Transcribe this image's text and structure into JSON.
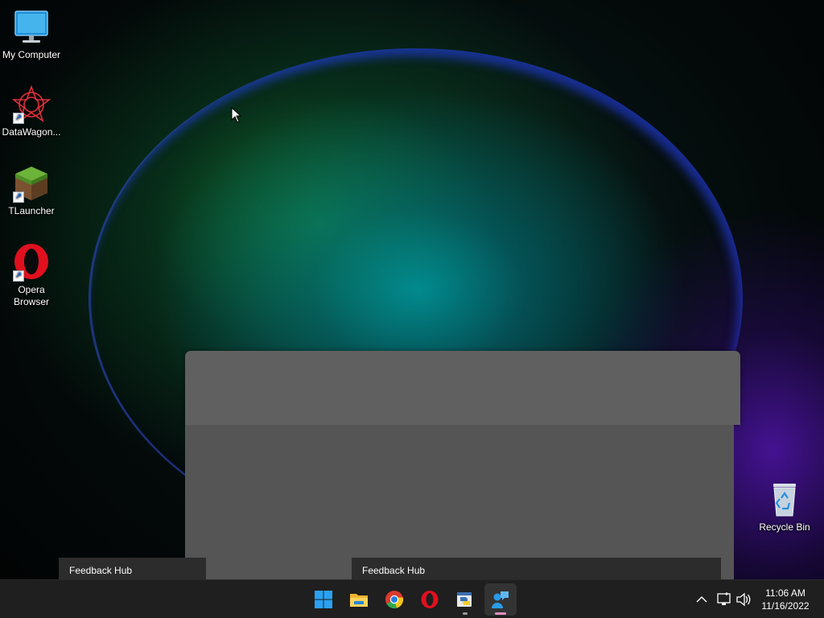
{
  "desktop": {
    "icons": [
      {
        "label": "My Computer"
      },
      {
        "label": "DataWagon..."
      },
      {
        "label": "TLauncher"
      },
      {
        "label": "Opera Browser"
      },
      {
        "label": "Recycle Bin"
      }
    ]
  },
  "preview": {
    "thumb_left": {
      "title": "Feedback Hub"
    },
    "thumb_right": {
      "title": "Feedback Hub"
    }
  },
  "taskbar": {
    "apps": [
      {
        "icon": "windows-start-icon"
      },
      {
        "icon": "file-explorer-icon"
      },
      {
        "icon": "chrome-icon"
      },
      {
        "icon": "opera-icon"
      },
      {
        "icon": "python-idle-icon"
      },
      {
        "icon": "feedback-hub-icon"
      }
    ],
    "tray": {
      "time": "11:06 AM",
      "date": "11/16/2022"
    }
  },
  "colors": {
    "taskbar_bg": "#1f1f1f",
    "window_gray": "#555555",
    "thumb_label_bg": "#2c2c2c",
    "active_indicator": "#e58fc0"
  }
}
